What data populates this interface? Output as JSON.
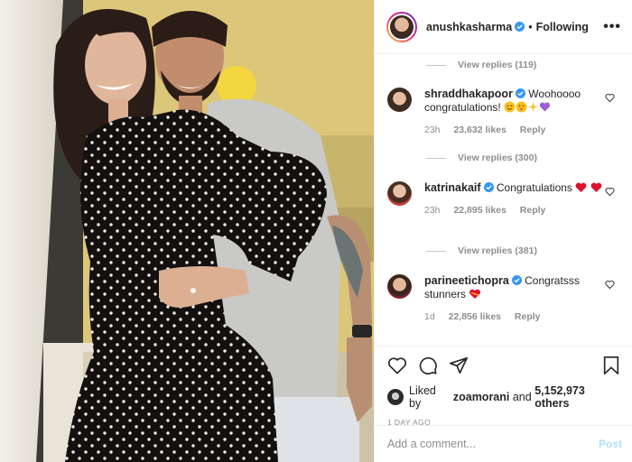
{
  "post": {
    "author": "anushkasharma",
    "separator": "•",
    "follow_status": "Following",
    "more_icon": "more-horizontal-icon"
  },
  "comments": [
    {
      "type": "replies",
      "label": "View replies (119)"
    },
    {
      "type": "comment",
      "user": "shraddhakapoor",
      "text": "Woohoooo congratulations!",
      "emojis": [
        "smile-emoji",
        "kiss-emoji",
        "sparkles-emoji",
        "purple-heart-emoji"
      ],
      "age": "23h",
      "likes": "23,632 likes",
      "reply": "Reply"
    },
    {
      "type": "replies",
      "label": "View replies (300)"
    },
    {
      "type": "comment",
      "user": "katrinakaif",
      "text": "Congratulations",
      "emojis": [
        "red-heart-emoji",
        "red-heart-emoji"
      ],
      "age": "23h",
      "likes": "22,895 likes",
      "reply": "Reply"
    },
    {
      "type": "replies",
      "label": "View replies (381)"
    },
    {
      "type": "comment",
      "user": "parineetichopra",
      "text": "Congratsss stunners",
      "emojis": [
        "heart-eyes-emoji"
      ],
      "age": "1d",
      "likes": "22,856 likes",
      "reply": "Reply"
    }
  ],
  "actions": {
    "like_icon": "heart-outline-icon",
    "comment_icon": "comment-icon",
    "share_icon": "share-icon",
    "save_icon": "bookmark-icon"
  },
  "likes": {
    "prefix": "Liked by",
    "user": "zoamorani",
    "middle": "and",
    "count": "5,152,973 others"
  },
  "timestamp": "1 DAY AGO",
  "add_comment": {
    "placeholder": "Add a comment...",
    "post_label": "Post"
  },
  "colors": {
    "verified": "#3897f0",
    "link_disabled": "#b2dffc",
    "meta": "#8e8e8e",
    "heart_red": "#ed4956"
  }
}
